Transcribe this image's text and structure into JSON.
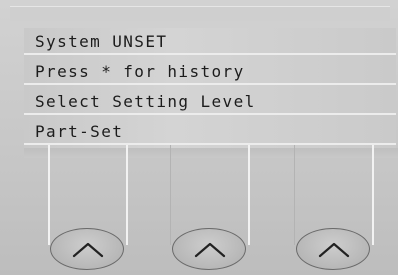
{
  "display": {
    "lines": [
      "System UNSET",
      "Press * for history",
      "Select Setting Level",
      "Part-Set"
    ]
  },
  "keys": [
    {
      "icon": "chevron-up-icon"
    },
    {
      "icon": "chevron-up-icon"
    },
    {
      "icon": "chevron-up-icon"
    }
  ]
}
